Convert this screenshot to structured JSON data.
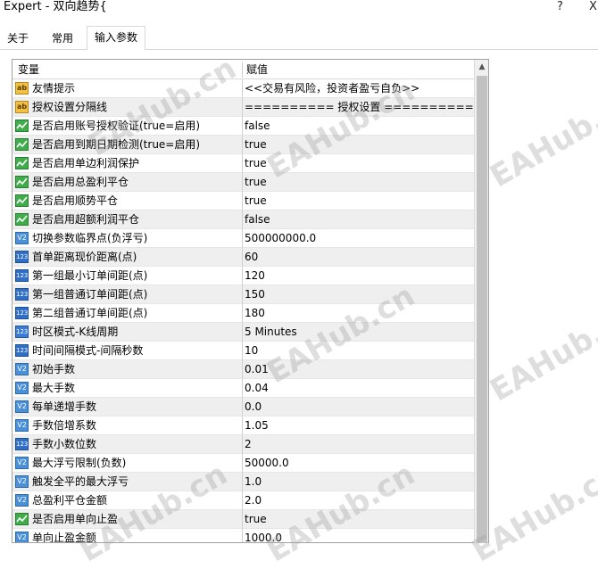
{
  "window": {
    "title": "Expert - 双向趋势{",
    "help_label": "?",
    "close_label": "X"
  },
  "tabs": [
    {
      "label": "关于"
    },
    {
      "label": "常用"
    },
    {
      "label": "输入参数",
      "active": true
    }
  ],
  "grid": {
    "col_variable": "变量",
    "col_value": "赋值",
    "rows": [
      {
        "type": "ab",
        "name": "友情提示",
        "value": "<<交易有风险，投资者盈亏自负>>"
      },
      {
        "type": "ab",
        "name": "授权设置分隔线",
        "value": "========== 授权设置 =========="
      },
      {
        "type": "bool",
        "name": "是否启用账号授权验证(true=启用)",
        "value": "false"
      },
      {
        "type": "bool",
        "name": "是否启用到期日期检测(true=启用)",
        "value": "true"
      },
      {
        "type": "bool",
        "name": "是否启用单边利润保护",
        "value": "true"
      },
      {
        "type": "bool",
        "name": "是否启用总盈利平仓",
        "value": "true"
      },
      {
        "type": "bool",
        "name": "是否启用顺势平仓",
        "value": "true"
      },
      {
        "type": "bool",
        "name": "是否启用超额利润平仓",
        "value": "false"
      },
      {
        "type": "dbl",
        "name": "切换参数临界点(负浮亏)",
        "value": "500000000.0"
      },
      {
        "type": "int",
        "name": "首单距离现价距离(点)",
        "value": "60"
      },
      {
        "type": "int",
        "name": "第一组最小订单间距(点)",
        "value": "120"
      },
      {
        "type": "int",
        "name": "第一组普通订单间距(点)",
        "value": "150"
      },
      {
        "type": "int",
        "name": "第二组普通订单间距(点)",
        "value": "180"
      },
      {
        "type": "enum",
        "name": "时区模式-K线周期",
        "value": "5 Minutes"
      },
      {
        "type": "int",
        "name": "时间间隔模式-间隔秒数",
        "value": "10"
      },
      {
        "type": "dbl",
        "name": "初始手数",
        "value": "0.01"
      },
      {
        "type": "dbl",
        "name": "最大手数",
        "value": "0.04"
      },
      {
        "type": "dbl",
        "name": "每单递增手数",
        "value": "0.0"
      },
      {
        "type": "dbl",
        "name": "手数倍增系数",
        "value": "1.05"
      },
      {
        "type": "int",
        "name": "手数小数位数",
        "value": "2"
      },
      {
        "type": "dbl",
        "name": "最大浮亏限制(负数)",
        "value": "50000.0"
      },
      {
        "type": "dbl",
        "name": "触发全平的最大浮亏",
        "value": "1.0"
      },
      {
        "type": "dbl",
        "name": "总盈利平仓金额",
        "value": "2.0"
      },
      {
        "type": "bool",
        "name": "是否启用单向止盈",
        "value": "true"
      },
      {
        "type": "dbl",
        "name": "单向止盈金额",
        "value": "1000.0"
      }
    ]
  },
  "icons": {
    "ab": "string-icon",
    "bool": "boolean-icon",
    "dbl": "double-icon",
    "int": "integer-icon",
    "enum": "enum-icon"
  },
  "watermark": "EAHub.cn"
}
